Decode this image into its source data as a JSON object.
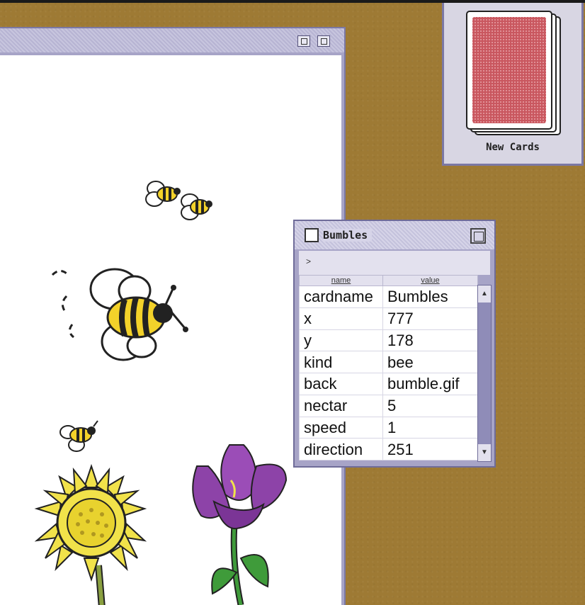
{
  "card_window": {
    "titlebar_buttons": [
      "zoom-icon",
      "collapse-icon"
    ]
  },
  "deck": {
    "label": "New Cards",
    "color": "#b0344a"
  },
  "inspector": {
    "title": "Bumbles",
    "path_arrow": ">",
    "columns": {
      "name": "name",
      "value": "value"
    },
    "rows": [
      {
        "name": "cardname",
        "value": "Bumbles"
      },
      {
        "name": "x",
        "value": "777"
      },
      {
        "name": "y",
        "value": "178"
      },
      {
        "name": "kind",
        "value": "bee"
      },
      {
        "name": "back",
        "value": "bumble.gif"
      },
      {
        "name": "nectar",
        "value": "5"
      },
      {
        "name": "speed",
        "value": "1"
      },
      {
        "name": "direction",
        "value": "251"
      }
    ],
    "scroll_up": "▲",
    "scroll_down": "▼"
  },
  "colors": {
    "desktop": "#9e7a34",
    "window_chrome": "#a7a4c7",
    "bee_yellow": "#f3d22a",
    "sunflower_yellow": "#f1e24a",
    "iris_purple": "#8d43a8",
    "stem_green": "#3f9b3a"
  }
}
